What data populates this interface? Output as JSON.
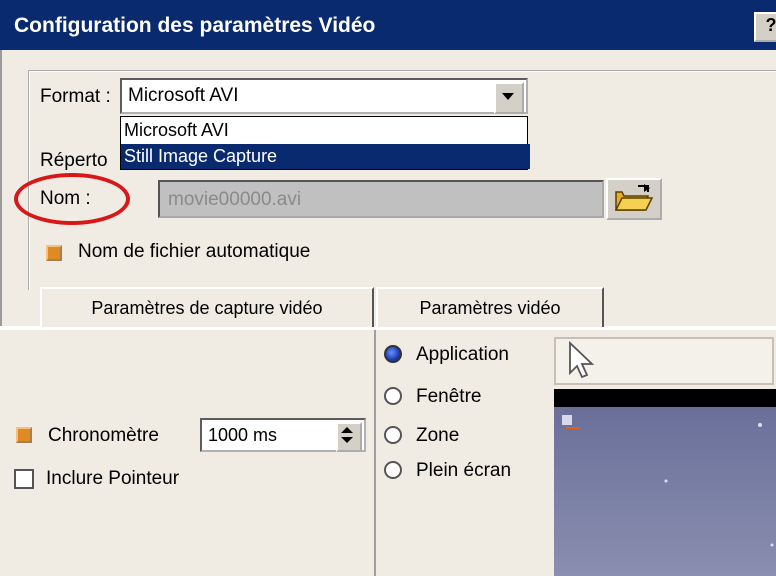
{
  "dialog": {
    "title": "Configuration des paramètres Vidéo",
    "help_label": "?"
  },
  "format": {
    "label": "Format :",
    "selected": "Microsoft AVI",
    "options": [
      "Microsoft AVI",
      "Still Image Capture"
    ],
    "highlighted_option": "Still Image Capture"
  },
  "repertoire": {
    "label_visible": "Réperto"
  },
  "nom": {
    "label": "Nom :",
    "value": "movie00000.avi"
  },
  "auto_filename": {
    "label": "Nom de fichier automatique",
    "checked": true
  },
  "tabs": [
    {
      "label": "Paramètres de capture vidéo",
      "active": false
    },
    {
      "label": "Paramètres vidéo",
      "active": true
    }
  ],
  "capture": {
    "chrono_label": "Chronomètre",
    "chrono_checked": true,
    "chrono_value": "1000 ms",
    "pointer_label": "Inclure Pointeur",
    "pointer_checked": false
  },
  "source": {
    "options": [
      "Application",
      "Fenêtre",
      "Zone",
      "Plein écran"
    ],
    "selected": "Application"
  },
  "icons": {
    "folder": "open-folder-icon",
    "pointer": "mouse-pointer-icon",
    "dropdown": "chevron-down-icon",
    "spinner": "spinner-arrows-icon"
  },
  "colors": {
    "titlebar": "#0a2a70",
    "panel": "#f0ebe3",
    "highlight": "#d81818",
    "checkbox": "#e08a24"
  }
}
